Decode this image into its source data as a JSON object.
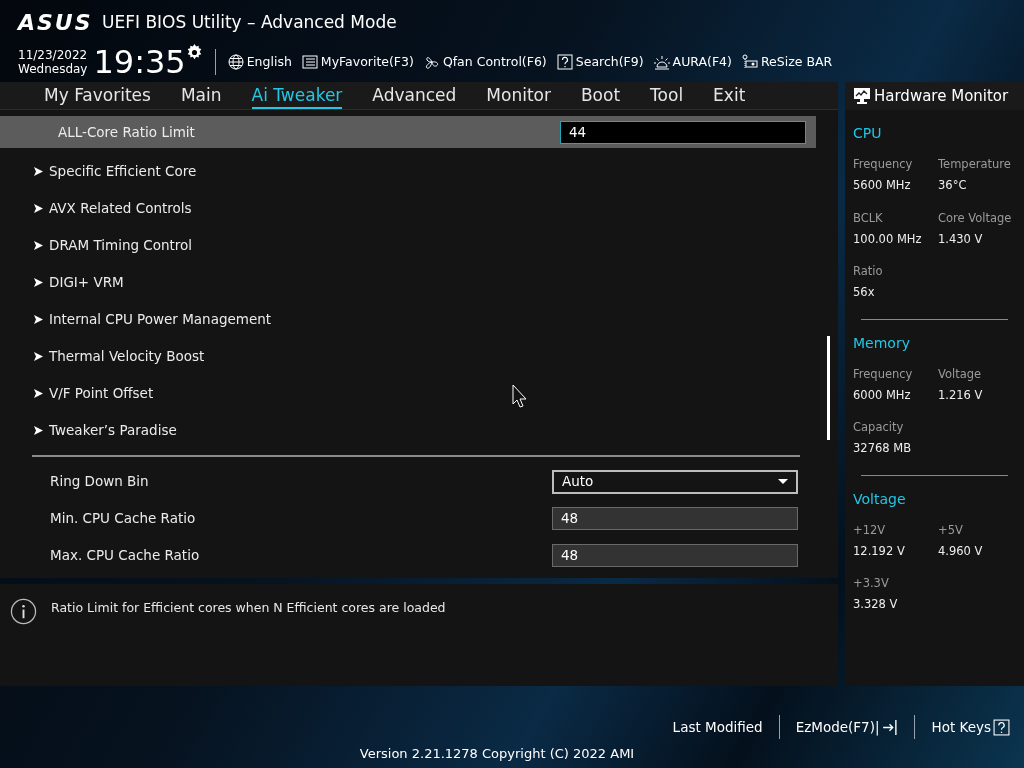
{
  "header": {
    "logo": "ASUS",
    "title": "UEFI BIOS Utility – Advanced Mode",
    "date": "11/23/2022",
    "day": "Wednesday",
    "time": "19:35",
    "toolbar": [
      {
        "kind": "globe",
        "label": "English"
      },
      {
        "kind": "list",
        "label": "MyFavorite(F3)"
      },
      {
        "kind": "fan",
        "label": "Qfan Control(F6)"
      },
      {
        "kind": "question",
        "label": "Search(F9)"
      },
      {
        "kind": "light",
        "label": "AURA(F4)"
      },
      {
        "kind": "card",
        "label": "ReSize BAR"
      }
    ]
  },
  "tabs": [
    {
      "label": "My Favorites",
      "selected": false
    },
    {
      "label": "Main",
      "selected": false
    },
    {
      "label": "Ai Tweaker",
      "selected": true
    },
    {
      "label": "Advanced",
      "selected": false
    },
    {
      "label": "Monitor",
      "selected": false
    },
    {
      "label": "Boot",
      "selected": false
    },
    {
      "label": "Tool",
      "selected": false
    },
    {
      "label": "Exit",
      "selected": false
    }
  ],
  "settings": [
    {
      "kind": "input",
      "label": "ALL-Core Ratio Limit",
      "value": "44",
      "selected": true
    },
    {
      "kind": "submenu",
      "label": "Specific Efficient Core",
      "selected": false
    },
    {
      "kind": "submenu",
      "label": "AVX Related Controls",
      "selected": false
    },
    {
      "kind": "submenu",
      "label": "DRAM Timing Control",
      "selected": false
    },
    {
      "kind": "submenu",
      "label": "DIGI+ VRM",
      "selected": false
    },
    {
      "kind": "submenu",
      "label": "Internal CPU Power Management",
      "selected": false
    },
    {
      "kind": "submenu",
      "label": "Thermal Velocity Boost",
      "selected": false
    },
    {
      "kind": "submenu",
      "label": "V/F Point Offset",
      "selected": false
    },
    {
      "kind": "submenu",
      "label": "Tweaker’s Paradise",
      "selected": false
    },
    {
      "kind": "divider"
    },
    {
      "kind": "dropdown",
      "label": "Ring Down Bin",
      "value": "Auto",
      "selected": false
    },
    {
      "kind": "input",
      "label": "Min. CPU Cache Ratio",
      "value": "48",
      "selected": false
    },
    {
      "kind": "input",
      "label": "Max. CPU Cache Ratio",
      "value": "48",
      "selected": false
    }
  ],
  "help": "Ratio Limit for Efficient cores when N Efficient cores are loaded",
  "hardware_monitor": {
    "title": "Hardware Monitor",
    "sections": [
      {
        "title": "CPU",
        "metrics": [
          {
            "label": "Frequency",
            "value": "5600 MHz"
          },
          {
            "label": "Temperature",
            "value": "36°C"
          },
          {
            "label": "BCLK",
            "value": "100.00 MHz"
          },
          {
            "label": "Core Voltage",
            "value": "1.430 V"
          },
          {
            "label": "Ratio",
            "value": "56x"
          }
        ]
      },
      {
        "title": "Memory",
        "metrics": [
          {
            "label": "Frequency",
            "value": "6000 MHz"
          },
          {
            "label": "Voltage",
            "value": "1.216 V"
          },
          {
            "label": "Capacity",
            "value": "32768 MB"
          }
        ]
      },
      {
        "title": "Voltage",
        "metrics": [
          {
            "label": "+12V",
            "value": "12.192 V"
          },
          {
            "label": "+5V",
            "value": "4.960 V"
          },
          {
            "label": "+3.3V",
            "value": "3.328 V"
          }
        ]
      }
    ]
  },
  "footer": {
    "buttons": [
      {
        "kind": "plain",
        "label": "Last Modified"
      },
      {
        "kind": "exit",
        "label": "EzMode(F7)|"
      },
      {
        "kind": "help",
        "label": "Hot Keys"
      }
    ],
    "version": "Version 2.21.1278 Copyright (C) 2022 AMI"
  }
}
